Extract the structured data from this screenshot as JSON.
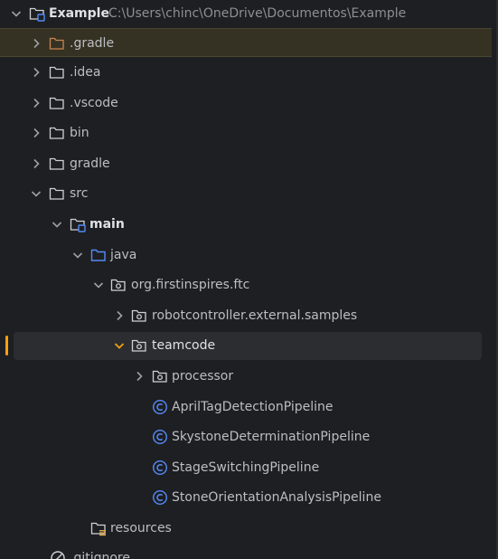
{
  "colors": {
    "background": "#1e1f22",
    "highlight_row": "#353223",
    "selected_row": "#2b2d30",
    "marker": "#f5a20b",
    "folder_stroke": "#ced0d6",
    "folder_orange": "#c98653",
    "folder_blue": "#548af7",
    "class_icon": "#548af7"
  },
  "tree": {
    "root": {
      "label": "Example",
      "path": "C:\\Users\\chinc\\OneDrive\\Documentos\\Example"
    },
    "items": [
      {
        "label": ".gradle"
      },
      {
        "label": ".idea"
      },
      {
        "label": ".vscode"
      },
      {
        "label": "bin"
      },
      {
        "label": "gradle"
      },
      {
        "label": "src"
      },
      {
        "label": "main"
      },
      {
        "label": "java"
      },
      {
        "label": "org.firstinspires.ftc"
      },
      {
        "label": "robotcontroller.external.samples"
      },
      {
        "label": "teamcode"
      },
      {
        "label": "processor"
      },
      {
        "label": "AprilTagDetectionPipeline"
      },
      {
        "label": "SkystoneDeterminationPipeline"
      },
      {
        "label": "StageSwitchingPipeline"
      },
      {
        "label": "StoneOrientationAnalysisPipeline"
      },
      {
        "label": "resources"
      },
      {
        "label": ".gitignore"
      }
    ]
  }
}
